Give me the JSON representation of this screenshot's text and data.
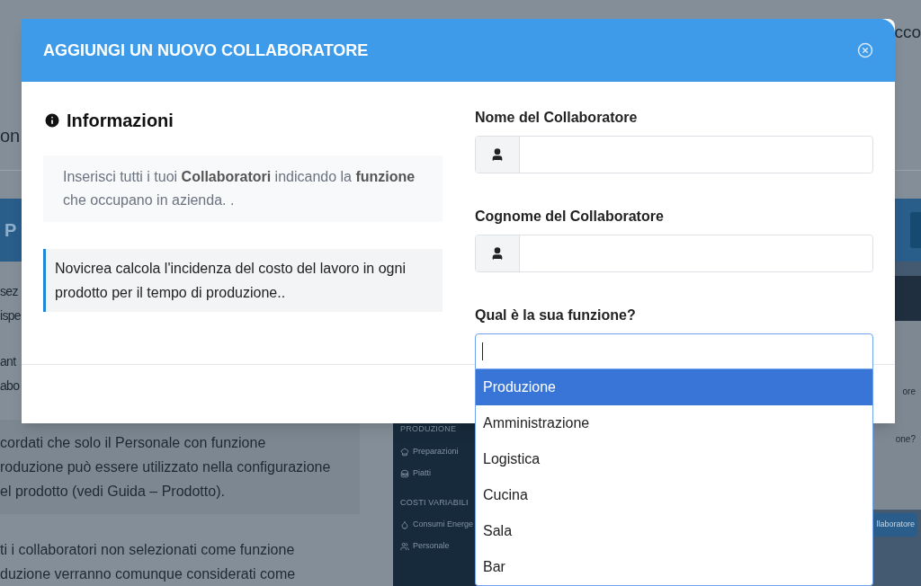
{
  "background": {
    "corner_text": "cco",
    "heading_fragment": "on",
    "band_fragment": "P",
    "paragraph_fragments": [
      "sez",
      "ispe",
      "ant",
      "abo"
    ],
    "note_lines": [
      "cordati che solo il Personale con funzione",
      "roduzione può essere utilizzato nella configurazione",
      "el prodotto (vedi Guida – Prodotto)."
    ],
    "trailing_lines": [
      "ti i collaboratori non selezionati come funzione",
      "duzione verranno comunque considerati come"
    ],
    "sidebar": [
      {
        "title": "PRODUZIONE",
        "items": [
          {
            "label": "Preparazioni",
            "kind": "hat"
          },
          {
            "label": "Piatti",
            "kind": "burger"
          }
        ]
      },
      {
        "title": "COSTI VARIABILI",
        "items": [
          {
            "label": "Consumi Energe",
            "kind": "drop"
          },
          {
            "label": "Personale",
            "kind": "users"
          }
        ]
      }
    ],
    "right_fragments": [
      "ore",
      "one?"
    ],
    "right_button": "llaboratore"
  },
  "modal": {
    "title": "AGGIUNGI UN NUOVO COLLABORATORE",
    "info_heading": "Informazioni",
    "info_text": "Inserisci tutti i tuoi **Collaboratori** indicando la **funzione** che occupano in azienda. .",
    "note": "Novicrea calcola l'incidenza del costo del lavoro in ogni prodotto per il tempo di produzione..",
    "fields": [
      {
        "label": "Nome del Collaboratore",
        "kind": "person"
      },
      {
        "label": "Cognome del Collaboratore",
        "kind": "person"
      },
      {
        "label": "Qual è la sua funzione?",
        "kind": "select",
        "options": [
          {
            "label": "Produzione",
            "selected": true
          },
          {
            "label": "Amministrazione",
            "selected": false
          },
          {
            "label": "Logistica",
            "selected": false
          },
          {
            "label": "Cucina",
            "selected": false
          },
          {
            "label": "Sala",
            "selected": false
          },
          {
            "label": "Bar",
            "selected": false
          }
        ]
      }
    ]
  }
}
